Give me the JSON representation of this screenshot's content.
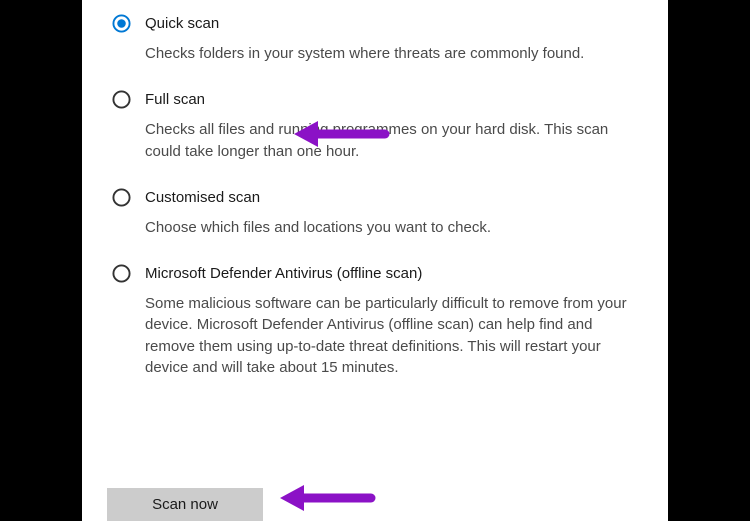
{
  "options": [
    {
      "title": "Quick scan",
      "desc": "Checks folders in your system where threats are commonly found.",
      "selected": true
    },
    {
      "title": "Full scan",
      "desc": "Checks all files and running programmes on your hard disk. This scan could take longer than one hour.",
      "selected": false
    },
    {
      "title": "Customised scan",
      "desc": "Choose which files and locations you want to check.",
      "selected": false
    },
    {
      "title": "Microsoft Defender Antivirus (offline scan)",
      "desc": "Some malicious software can be particularly difficult to remove from your device. Microsoft Defender Antivirus (offline scan) can help find and remove them using up-to-date threat definitions. This will restart your device and will take about 15 minutes.",
      "selected": false
    }
  ],
  "actions": {
    "scan_now_label": "Scan now"
  },
  "colors": {
    "accent": "#0078d4",
    "annotation_arrow": "#8b12c6"
  }
}
